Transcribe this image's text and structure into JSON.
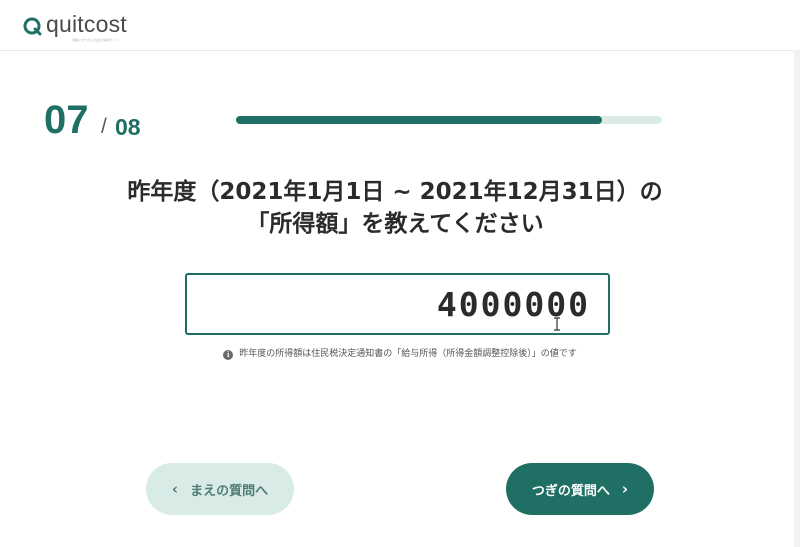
{
  "brand": {
    "name": "quitcost",
    "tagline": "退職にまつわるお金の情報サイト"
  },
  "progress": {
    "current": "07",
    "separator": "/",
    "total": "08",
    "fraction": 0.86
  },
  "question": {
    "line1": "昨年度（2021年1月1日 ~ 2021年12月31日）の",
    "line2": "「所得額」を教えてください"
  },
  "income_input": {
    "value": "4000000"
  },
  "note": {
    "text": "昨年度の所得額は住民税決定通知書の「給与所得（所得金額調整控除後）」の値です"
  },
  "nav": {
    "prev_label": "まえの質問へ",
    "next_label": "つぎの質問へ"
  },
  "colors": {
    "accent": "#1f6f64",
    "accent_light": "#d8ebe6",
    "track": "#dcebe8"
  },
  "icons": {
    "logo": "logo-q-icon",
    "info": "info-icon",
    "prev": "chevron-left-icon",
    "next": "chevron-right-icon",
    "cursor": "text-cursor-icon"
  }
}
